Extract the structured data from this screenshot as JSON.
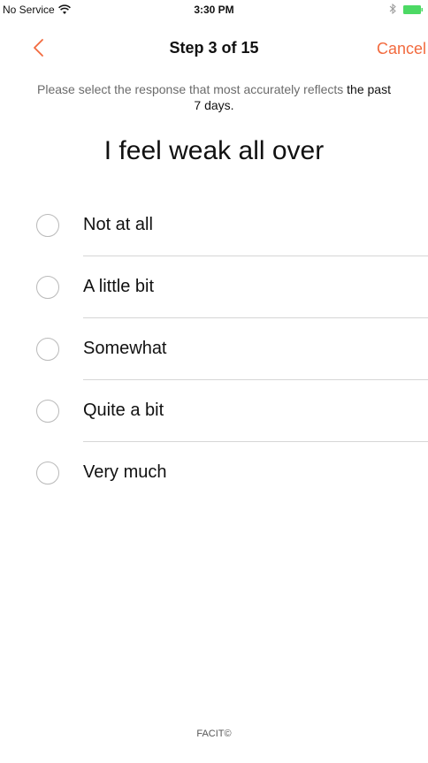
{
  "status_bar": {
    "carrier": "No Service",
    "time": "3:30 PM",
    "battery_color": "#4cd964"
  },
  "nav": {
    "title": "Step 3 of 15",
    "cancel_label": "Cancel",
    "accent_color": "#f26a3e"
  },
  "instruction": {
    "text_before": "Please select the response that most accurately reflects ",
    "emphasis": "the past 7 days."
  },
  "question": "I feel weak all over",
  "options": [
    {
      "label": "Not at all"
    },
    {
      "label": "A little bit"
    },
    {
      "label": "Somewhat"
    },
    {
      "label": "Quite a bit"
    },
    {
      "label": "Very much"
    }
  ],
  "footer": "FACIT©"
}
